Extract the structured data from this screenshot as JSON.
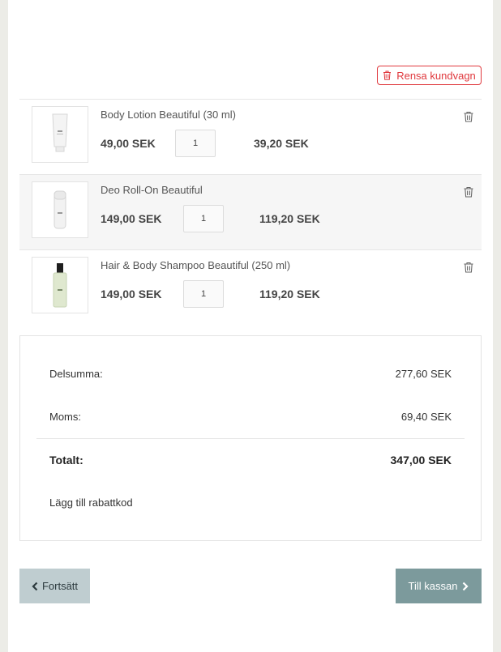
{
  "cart": {
    "clear_label": "Rensa kundvagn",
    "items": [
      {
        "name": "Body Lotion Beautiful (30 ml)",
        "price": "49,00 SEK",
        "qty": "1",
        "total": "39,20 SEK"
      },
      {
        "name": "Deo Roll-On Beautiful",
        "price": "149,00 SEK",
        "qty": "1",
        "total": "119,20 SEK"
      },
      {
        "name": "Hair & Body Shampoo Beautiful (250 ml)",
        "price": "149,00 SEK",
        "qty": "1",
        "total": "119,20 SEK"
      }
    ]
  },
  "summary": {
    "subtotal_label": "Delsumma:",
    "subtotal_value": "277,60 SEK",
    "vat_label": "Moms:",
    "vat_value": "69,40 SEK",
    "total_label": "Totalt:",
    "total_value": "347,00 SEK",
    "discount_label": "Lägg till rabattkod"
  },
  "actions": {
    "back_label": "Fortsätt",
    "checkout_label": "Till kassan"
  },
  "colors": {
    "danger": "#e0393e",
    "checkout": "#7c9a9c",
    "back": "#bfcdd0"
  }
}
